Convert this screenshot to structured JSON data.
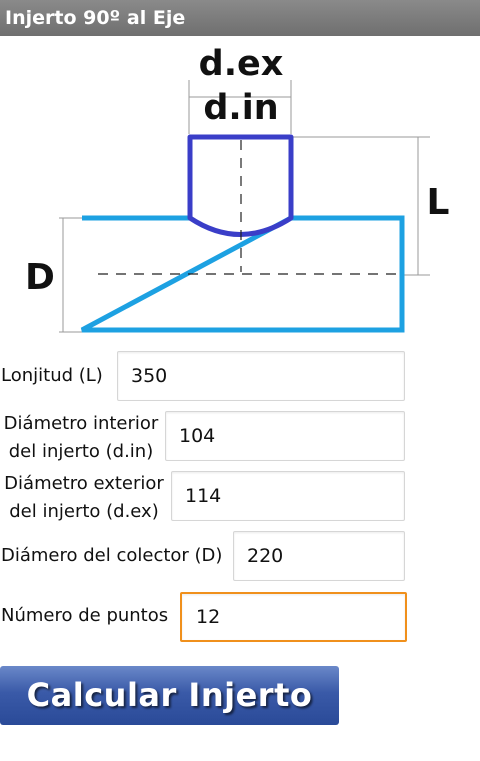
{
  "app": {
    "title": "Injerto 90º al Eje"
  },
  "diagram": {
    "label_dex": "d.ex",
    "label_din": "d.in",
    "label_L": "L",
    "label_D": "D",
    "colors": {
      "collector": "#1da1e2",
      "branch": "#3a3ec8"
    }
  },
  "form": {
    "lonjitud": {
      "label": "Lonjitud (L)",
      "value": "350"
    },
    "diam_int": {
      "label_line1": "Diámetro interior",
      "label_line2": "del injerto (d.in)",
      "value": "104"
    },
    "diam_ext": {
      "label_line1": "Diámetro exterior",
      "label_line2": "del injerto (d.ex)",
      "value": "114"
    },
    "colector": {
      "label": "Diámero del colector (D)",
      "value": "220"
    },
    "puntos": {
      "label": "Número de puntos",
      "value": "12"
    }
  },
  "button": {
    "label": "Calcular Injerto"
  }
}
